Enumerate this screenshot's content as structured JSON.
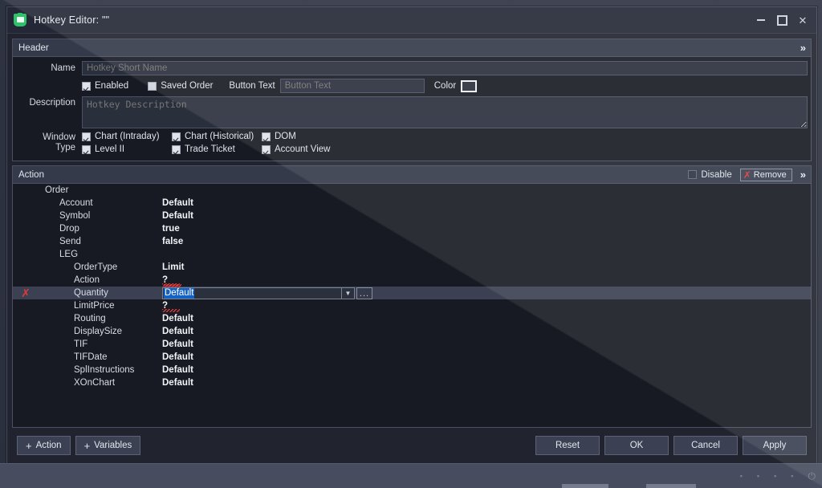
{
  "window": {
    "title": "Hotkey Editor: \"\"",
    "app_icon": "green-shield-icon",
    "controls": {
      "minimize": "minimize-icon",
      "maximize": "maximize-icon",
      "close": "close-icon"
    }
  },
  "header_section": {
    "title": "Header",
    "expand_icon": "»",
    "name_label": "Name",
    "name_placeholder": "Hotkey Short Name",
    "name_value": "",
    "enabled_label": "Enabled",
    "enabled_checked": true,
    "saved_order_label": "Saved Order",
    "saved_order_checked": false,
    "button_text_label": "Button Text",
    "button_text_placeholder": "Button Text",
    "button_text_value": "",
    "color_label": "Color",
    "color_value": "#2a2f3c",
    "description_label": "Description",
    "description_placeholder": "Hotkey Description",
    "description_value": "",
    "window_type_label_line1": "Window",
    "window_type_label_line2": "Type",
    "window_types": [
      {
        "label": "Chart (Intraday)",
        "checked": true
      },
      {
        "label": "Chart (Historical)",
        "checked": true
      },
      {
        "label": "DOM",
        "checked": true
      },
      {
        "label": "Level II",
        "checked": true
      },
      {
        "label": "Trade Ticket",
        "checked": true
      },
      {
        "label": "Account View",
        "checked": true
      }
    ]
  },
  "action_section": {
    "title": "Action",
    "disable_label": "Disable",
    "disable_checked": false,
    "remove_label": "Remove",
    "remove_icon": "red-x-icon",
    "expand_icon": "»",
    "tree": [
      {
        "indent": 0,
        "name": "Order",
        "value": "",
        "error": false,
        "selected": false
      },
      {
        "indent": 1,
        "name": "Account",
        "value": "Default",
        "error": false,
        "selected": false
      },
      {
        "indent": 1,
        "name": "Symbol",
        "value": "Default",
        "error": false,
        "selected": false
      },
      {
        "indent": 1,
        "name": "Drop",
        "value": "true",
        "error": false,
        "selected": false
      },
      {
        "indent": 1,
        "name": "Send",
        "value": "false",
        "error": false,
        "selected": false
      },
      {
        "indent": 1,
        "name": "LEG",
        "value": "",
        "error": false,
        "selected": false
      },
      {
        "indent": 2,
        "name": "OrderType",
        "value": "Limit",
        "error": false,
        "selected": false
      },
      {
        "indent": 2,
        "name": "Action",
        "value": "?",
        "error": true,
        "selected": false
      },
      {
        "indent": 2,
        "name": "Quantity",
        "value": "Default",
        "error": true,
        "selected": true,
        "editing": true
      },
      {
        "indent": 2,
        "name": "LimitPrice",
        "value": "?",
        "error": true,
        "selected": false
      },
      {
        "indent": 2,
        "name": "Routing",
        "value": "Default",
        "error": false,
        "selected": false
      },
      {
        "indent": 2,
        "name": "DisplaySize",
        "value": "Default",
        "error": false,
        "selected": false
      },
      {
        "indent": 2,
        "name": "TIF",
        "value": "Default",
        "error": false,
        "selected": false
      },
      {
        "indent": 2,
        "name": "TIFDate",
        "value": "Default",
        "error": false,
        "selected": false
      },
      {
        "indent": 2,
        "name": "SplInstructions",
        "value": "Default",
        "error": false,
        "selected": false
      },
      {
        "indent": 2,
        "name": "XOnChart",
        "value": "Default",
        "error": false,
        "selected": false
      }
    ],
    "editor": {
      "selected_text": "Default",
      "dropdown_icon": "chevron-down-icon",
      "ellipsis_label": "...",
      "highlight_color": "#1562c6"
    }
  },
  "footer": {
    "add_action_label": "Action",
    "add_variables_label": "Variables",
    "plus_icon": "+",
    "reset_label": "Reset",
    "ok_label": "OK",
    "cancel_label": "Cancel",
    "apply_label": "Apply"
  }
}
